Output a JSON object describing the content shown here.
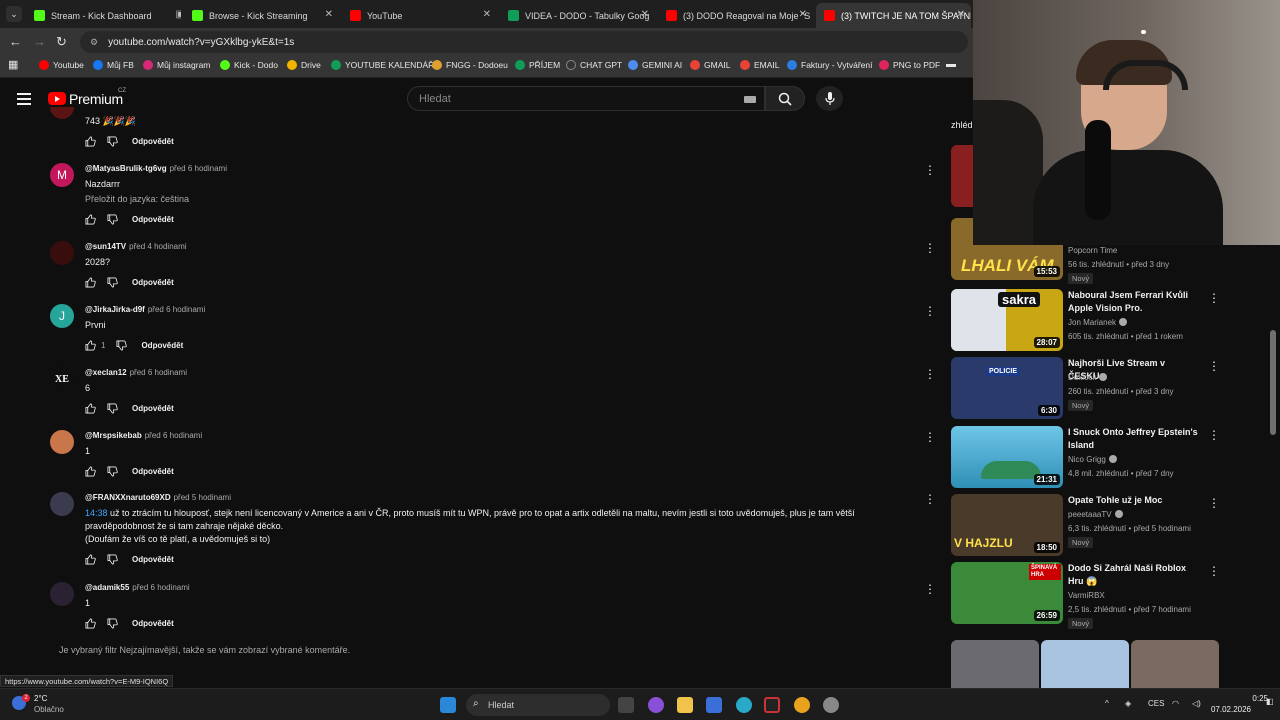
{
  "browser": {
    "tabs": [
      {
        "title": "Stream - Kick Dashboard",
        "color": "#53fc18",
        "active": false
      },
      {
        "title": "Browse - Kick Streaming",
        "color": "#53fc18",
        "active": false
      },
      {
        "title": "YouTube",
        "color": "#ff0000",
        "active": false
      },
      {
        "title": "VIDEA - DODO - Tabulky Goog",
        "color": "#0f9d58",
        "active": false
      },
      {
        "title": "(3) DODO Reagoval na Moje \"S",
        "color": "#ff0000",
        "active": false
      },
      {
        "title": "(3) TWITCH JE NA TOM ŠPATNĚ",
        "color": "#ff0000",
        "active": true
      }
    ],
    "url": "youtube.com/watch?v=yGXklbg-ykE&t=1s",
    "bookmarks": [
      {
        "label": "Youtube",
        "color": "#ff0000"
      },
      {
        "label": "Můj FB",
        "color": "#1877f2"
      },
      {
        "label": "Můj instagram",
        "color": "#d62976"
      },
      {
        "label": "Kick - Dodo",
        "color": "#53fc18"
      },
      {
        "label": "Drive",
        "color": "#f4b400"
      },
      {
        "label": "YOUTUBE KALENDÁŘ",
        "color": "#0f9d58"
      },
      {
        "label": "FNGG - Dodoeu",
        "color": "#e0a030"
      },
      {
        "label": "PŘÍJEM",
        "color": "#0f9d58"
      },
      {
        "label": "CHAT GPT",
        "color": "#333333"
      },
      {
        "label": "GEMINI AI",
        "color": "#4e8cf0"
      },
      {
        "label": "GMAIL",
        "color": "#ea4335"
      },
      {
        "label": "EMAIL",
        "color": "#ea4335"
      },
      {
        "label": "Faktury - Vytváření",
        "color": "#2a7de1"
      },
      {
        "label": "PNG to PDF",
        "color": "#e0245e"
      }
    ],
    "status_link": "https://www.youtube.com/watch?v=E-M9-IQNI6Q"
  },
  "youtube": {
    "logo_text": "Premium",
    "country": "CZ",
    "search_placeholder": "Hledat"
  },
  "comments": {
    "partial_top": {
      "text": "743 🎉🎉🎉",
      "reply_label": "Odpovědět"
    },
    "items": [
      {
        "author": "@MatyasBrulik-tg6vg",
        "time": "před 6 hodinami",
        "text": "Nazdarrr",
        "translate": "Přeložit do jazyka: čeština",
        "likes": "",
        "reply": "Odpovědět",
        "avatar_letter": "M",
        "avatar_color": "#c2185b"
      },
      {
        "author": "@sun14TV",
        "time": "před 4 hodinami",
        "text": "2028?",
        "likes": "",
        "reply": "Odpovědět",
        "avatar_letter": "",
        "avatar_color": "#3a0d0d"
      },
      {
        "author": "@JirkaJirka-d9f",
        "time": "před 6 hodinami",
        "text": "Prvni",
        "likes": "1",
        "reply": "Odpovědět",
        "avatar_letter": "J",
        "avatar_color": "#26a69a"
      },
      {
        "author": "@xeclan12",
        "time": "před 6 hodinami",
        "text": "6",
        "likes": "",
        "reply": "Odpovědět",
        "avatar_letter": "XE",
        "avatar_color": "#0f0f0f"
      },
      {
        "author": "@Mrspsikebab",
        "time": "před 6 hodinami",
        "text": "1",
        "likes": "",
        "reply": "Odpovědět",
        "avatar_letter": "",
        "avatar_color": "#c9774a"
      },
      {
        "author": "@FRANXXnaruto69XD",
        "time": "před 5 hodinami",
        "timestamp": "14:38",
        "text": " už to ztrácím tu hlouposť, stejk není licencovaný v Americe a ani v ČR, proto musíš mít tu WPN, právě pro to opat a artix odletěli na maltu, nevím jestli si toto uvědomuješ, plus je tam větší pravděpodobnost že si tam zahraje nějaké děcko.",
        "text2": "(Doufám že víš co tě platí, a uvědomuješ si to)",
        "likes": "",
        "reply": "Odpovědět",
        "avatar_letter": "",
        "avatar_color": "#3b3b4f"
      },
      {
        "author": "@adamik55",
        "time": "před 6 hodinami",
        "text": "1",
        "likes": "",
        "reply": "Odpovědět",
        "avatar_letter": "",
        "avatar_color": "#2a2233"
      }
    ],
    "filter_note": "Je vybraný filtr Nejzajímavější, takže se vám zobrazí vybrané komentáře."
  },
  "sidebar": {
    "partial_label": "zhléd",
    "videos": [
      {
        "thumb_text": "LHALI VÁM",
        "title": "",
        "channel": "Popcorn Time",
        "meta": "56 tis. zhlédnutí • před 3 dny",
        "badge": "Nový",
        "duration": "15:53",
        "thumb_color": "#8a6a2a"
      },
      {
        "thumb_text": "sakra",
        "title": "Naboural Jsem Ferrari Kvůli Apple Vision Pro.",
        "channel": "Jon Marianek",
        "meta": "605 tis. zhlédnutí • před 1 rokem",
        "badge": "",
        "duration": "28:07",
        "thumb_color": "#c9a614"
      },
      {
        "thumb_text": "POLICIE",
        "title": "Najhorši Live Stream v ČESKU",
        "channel": "Duklock",
        "meta": "260 tis. zhlédnutí • před 3 dny",
        "badge": "Nový",
        "duration": "6:30",
        "thumb_color": "#2a3a6a"
      },
      {
        "thumb_text": "",
        "title": "I Snuck Onto Jeffrey Epstein's Island",
        "channel": "Nico Grigg",
        "meta": "4,8 mil. zhlédnutí • před 7 dny",
        "badge": "",
        "duration": "21:31",
        "thumb_color": "#2f8fb5"
      },
      {
        "thumb_text": "V HAJZLU",
        "title": "Opate Tohle už je Moc",
        "channel": "peeetaaaTV",
        "meta": "6,3 tis. zhlédnutí • před 5 hodinami",
        "badge": "Nový",
        "duration": "18:50",
        "thumb_color": "#4a3a2a"
      },
      {
        "thumb_text": "ŠPINAVÁ HRA",
        "title": "Dodo Si Zahrál Naši Roblox Hru 😱",
        "channel": "VarmiRBX",
        "meta": "2,5 tis. zhlédnutí • před 7 hodinami",
        "badge": "Nový",
        "duration": "26:59",
        "thumb_color": "#3a8a3a"
      }
    ]
  },
  "taskbar": {
    "weather_temp": "2°C",
    "weather_desc": "Oblačno",
    "search_placeholder": "Hledat",
    "lang": "CES",
    "time": "0:25",
    "date": "07.02.2026"
  }
}
